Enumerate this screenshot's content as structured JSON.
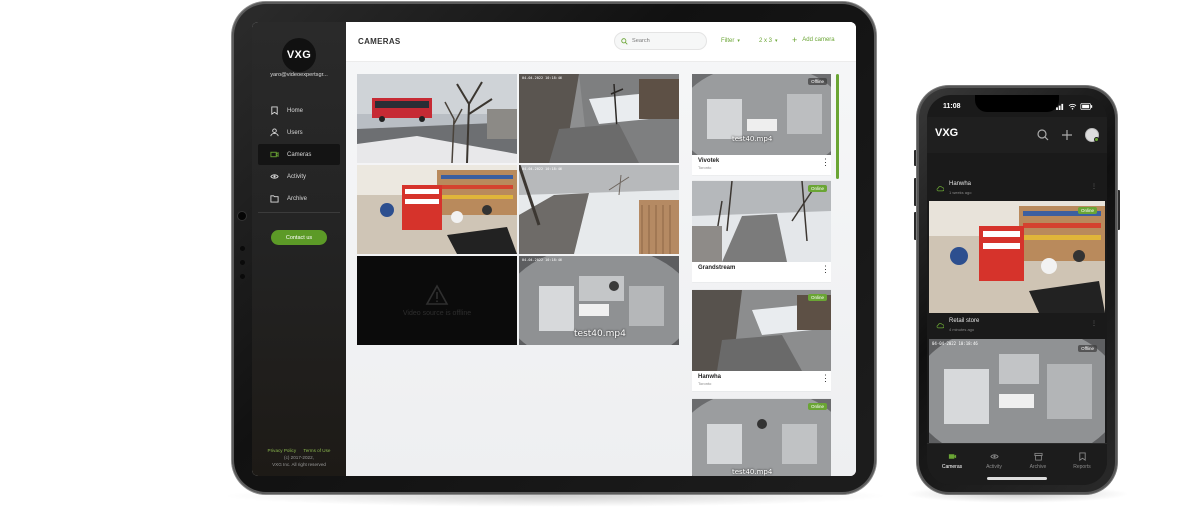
{
  "tablet": {
    "sidebar": {
      "logo": "VXG",
      "email": "yaro@videoexpertsgr...",
      "items": [
        {
          "label": "Home",
          "icon": "bookmark-icon"
        },
        {
          "label": "Users",
          "icon": "user-icon"
        },
        {
          "label": "Cameras",
          "icon": "camera-icon"
        },
        {
          "label": "Activity",
          "icon": "eye-icon"
        },
        {
          "label": "Archive",
          "icon": "folder-icon"
        }
      ],
      "active": "Cameras",
      "contact_label": "Contact us",
      "privacy_label": "Privacy Policy",
      "terms_label": "Terms of Use",
      "copyright": "(c) 2017-2022,",
      "copyright2": "VXG Inc. All right reserved"
    },
    "topbar": {
      "title": "CAMERAS",
      "search_placeholder": "Search",
      "filter_label": "Filter",
      "layout_label": "2 x 3",
      "add_label": "Add camera"
    },
    "grid": {
      "offline_text": "Video source is offline",
      "tile_label": "test40.mp4",
      "stamp": "04-04-2022 10:18:46"
    },
    "cameras": [
      {
        "name": "Vivotek",
        "location": "Toronto",
        "status": "Offline",
        "overlay": "test40.mp4"
      },
      {
        "name": "Grandstream",
        "location": "",
        "status": "Online",
        "overlay": ""
      },
      {
        "name": "Hanwha",
        "location": "Toronto",
        "status": "Online",
        "overlay": ""
      },
      {
        "name": "",
        "location": "",
        "status": "Online",
        "overlay": "test40.mp4"
      }
    ]
  },
  "phone": {
    "time": "11:08",
    "logo": "VXG",
    "rows": [
      {
        "name": "Hanwha",
        "time": "1 weeks ago",
        "badge": "Online"
      },
      {
        "name": "Retail store",
        "time": "4 minutes ago",
        "badge": "Offline"
      }
    ],
    "tabs": [
      "Cameras",
      "Activity",
      "Archive",
      "Reports"
    ],
    "active_tab": "Cameras"
  },
  "colors": {
    "accent": "#6aa534",
    "sidebar_bg": "#262626",
    "offline_bg": "#0b0b0b"
  }
}
